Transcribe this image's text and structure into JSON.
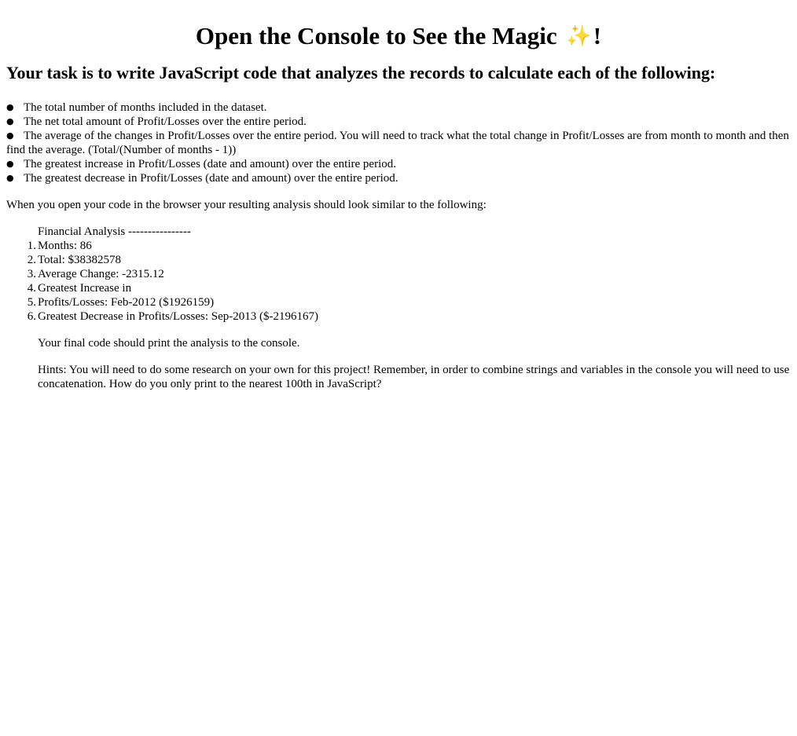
{
  "title": {
    "text": "Open the Console to See the Magic",
    "emoji": "✨",
    "suffix": "!"
  },
  "task_heading": "Your task is to write JavaScript code that analyzes the records to calculate each of the following:",
  "task_items": [
    "The total number of months included in the dataset.",
    "The net total amount of Profit/Losses over the entire period.",
    "The average of the changes in Profit/Losses over the entire period. You will need to track what the total change in Profit/Losses are from month to month and then find the average. (Total/(Number of months - 1))",
    "The greatest increase in Profit/Losses (date and amount) over the entire period.",
    "The greatest decrease in Profit/Losses (date and amount) over the entire period."
  ],
  "intro_text": "When you open your code in the browser your resulting analysis should look similar to the following:",
  "example": {
    "heading": "Financial Analysis ----------------",
    "lines": [
      "Months: 86",
      "Total: $38382578",
      "Average Change: -2315.12",
      "Greatest Increase in",
      "Profits/Losses: Feb-2012 ($1926159)",
      "Greatest Decrease in Profits/Losses: Sep-2013 ($-2196167)"
    ],
    "numbers": [
      "1.",
      "2.",
      "3.",
      "4.",
      "5.",
      "6."
    ]
  },
  "final_text": "Your final code should print the analysis to the console.",
  "hints_text": "Hints: You will need to do some research on your own for this project! Remember, in order to combine strings and variables in the console you will need to use concatenation. How do you only print to the nearest 100th in JavaScript?",
  "colors": {
    "text": "#000000",
    "background": "#ffffff",
    "sparkle": "#f4b400"
  },
  "icons": {
    "sparkle": "sparkles-icon",
    "bullet": "disc-bullet"
  }
}
